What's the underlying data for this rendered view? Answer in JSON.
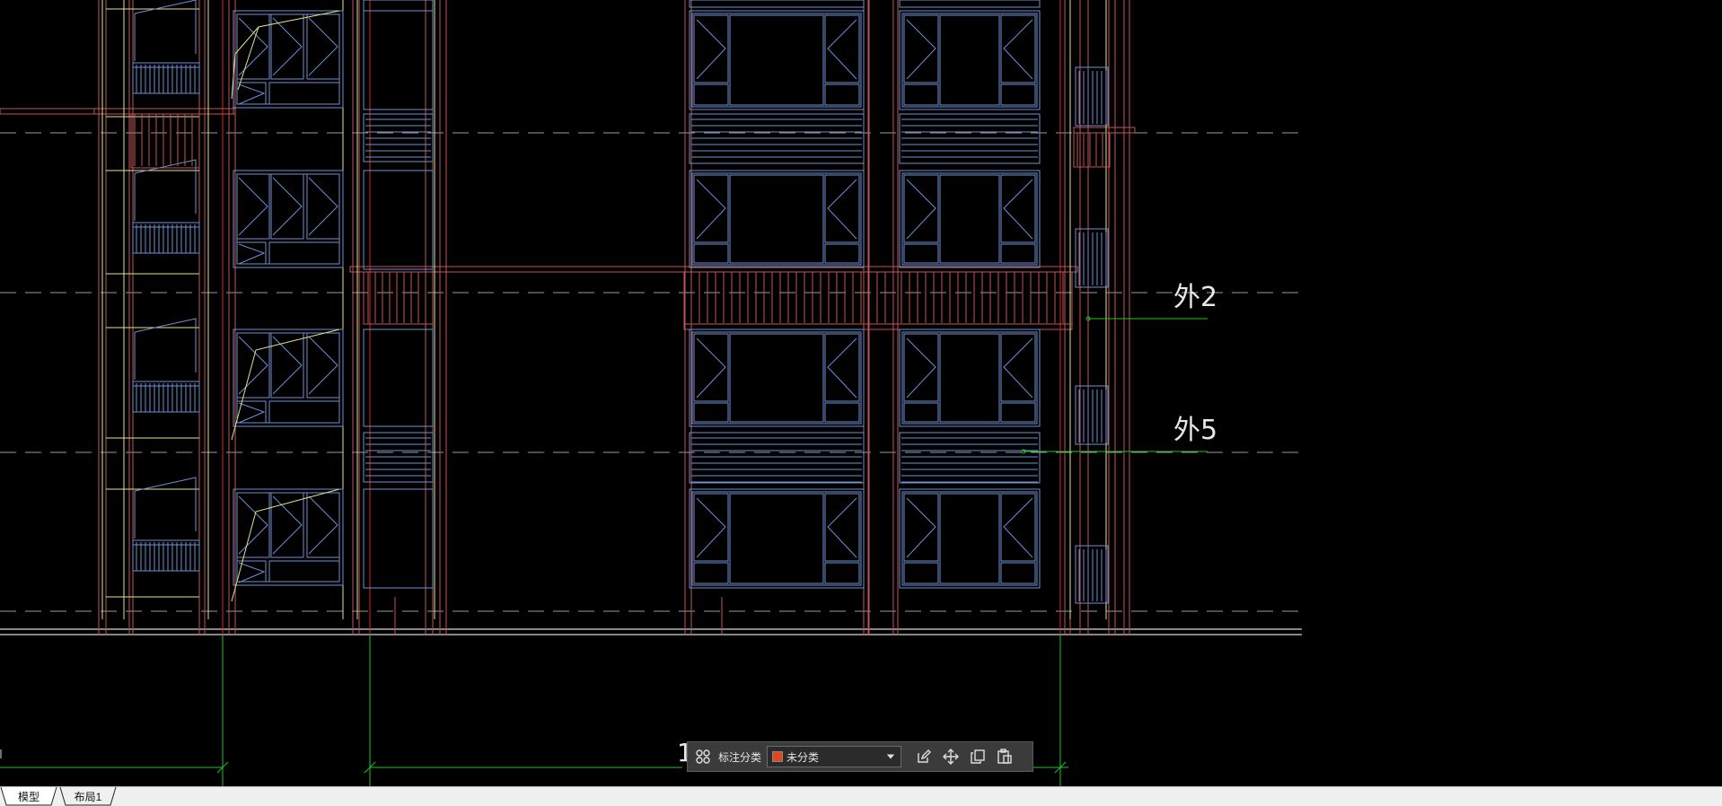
{
  "drawing": {
    "callouts": [
      {
        "id": "wai2",
        "label": "外2"
      },
      {
        "id": "wai5",
        "label": "外5"
      }
    ],
    "cut_dimension_text": "1"
  },
  "toolbar": {
    "category_label": "标注分类",
    "selected_category": "未分类",
    "selected_color": "#e0471a",
    "icons": [
      "grid-icon",
      "edit-icon",
      "move-icon",
      "copy-icon",
      "paste-icon"
    ]
  },
  "tabs": [
    {
      "label": "模型",
      "active": true
    },
    {
      "label": "布局1",
      "active": false
    }
  ],
  "colors": {
    "background": "#000000",
    "structure": "#c25656",
    "window": "#6e8fd2",
    "outline": "#e3e38f",
    "leader": "#22c22b",
    "centerline": "#d42a2a",
    "dash_grid": "#9a9a9a"
  }
}
